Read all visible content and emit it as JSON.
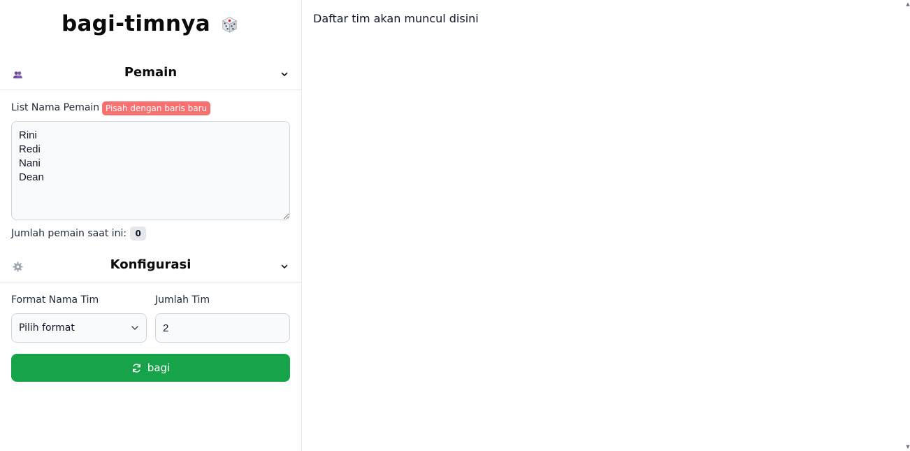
{
  "app": {
    "title": "bagi-timnya"
  },
  "sections": {
    "players": {
      "title": "Pemain"
    },
    "config": {
      "title": "Konfigurasi"
    }
  },
  "players_form": {
    "label": "List Nama Pemain",
    "hint_badge": "Pisah dengan baris baru",
    "textarea_value": "Rini\nRedi\nNani\nDean",
    "count_label": "Jumlah pemain saat ini:",
    "count_value": "0"
  },
  "config_form": {
    "format_label": "Format Nama Tim",
    "format_selected": "Pilih format",
    "team_count_label": "Jumlah Tim",
    "team_count_value": "2"
  },
  "actions": {
    "split_label": "bagi"
  },
  "main": {
    "empty_message": "Daftar tim akan muncul disini"
  },
  "colors": {
    "accent_green": "#16a34a",
    "badge_red": "#f87171",
    "players_icon_purple": "#6b4c9a",
    "gear_icon_gray": "#9ca3af"
  },
  "icons": {
    "title": "dice-icon",
    "players": "users-icon",
    "config": "gear-icon",
    "collapse": "chevron-down-icon",
    "split": "refresh-icon"
  }
}
